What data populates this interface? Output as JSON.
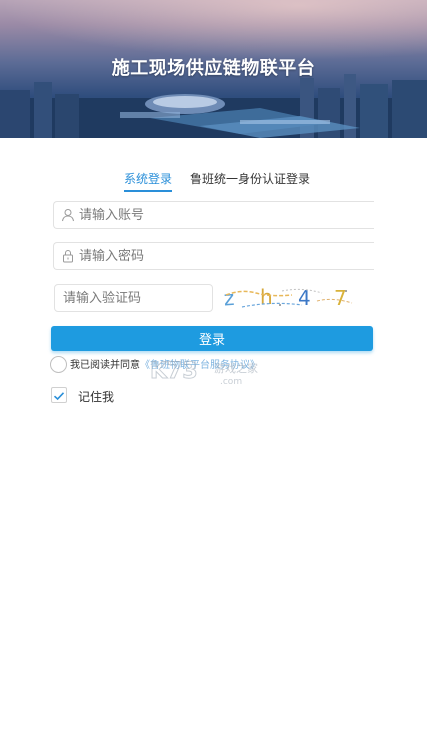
{
  "header": {
    "title": "施工现场供应链物联平台"
  },
  "tabs": [
    {
      "label": "系统登录",
      "active": true
    },
    {
      "label": "鲁班统一身份认证登录",
      "active": false
    }
  ],
  "form": {
    "account": {
      "placeholder": "请输入账号",
      "value": "",
      "icon": "user-icon"
    },
    "password": {
      "placeholder": "请输入密码",
      "value": "",
      "icon": "lock-icon"
    },
    "captcha": {
      "placeholder": "请输入验证码",
      "value": "",
      "image_text": "zh47"
    },
    "login_label": "登录",
    "agreement_prefix": "我已阅读并同意",
    "agreement_link": "《鲁班物联平台服务协议》",
    "remember_label": "记住我",
    "remember_checked": true
  },
  "watermark": {
    "text_main": "K73",
    "text_sub": "游戏之家",
    "text_dom": ".com"
  },
  "colors": {
    "accent": "#1e9be0",
    "tab_active": "#2a8fd9",
    "link": "#7fb4e0"
  }
}
